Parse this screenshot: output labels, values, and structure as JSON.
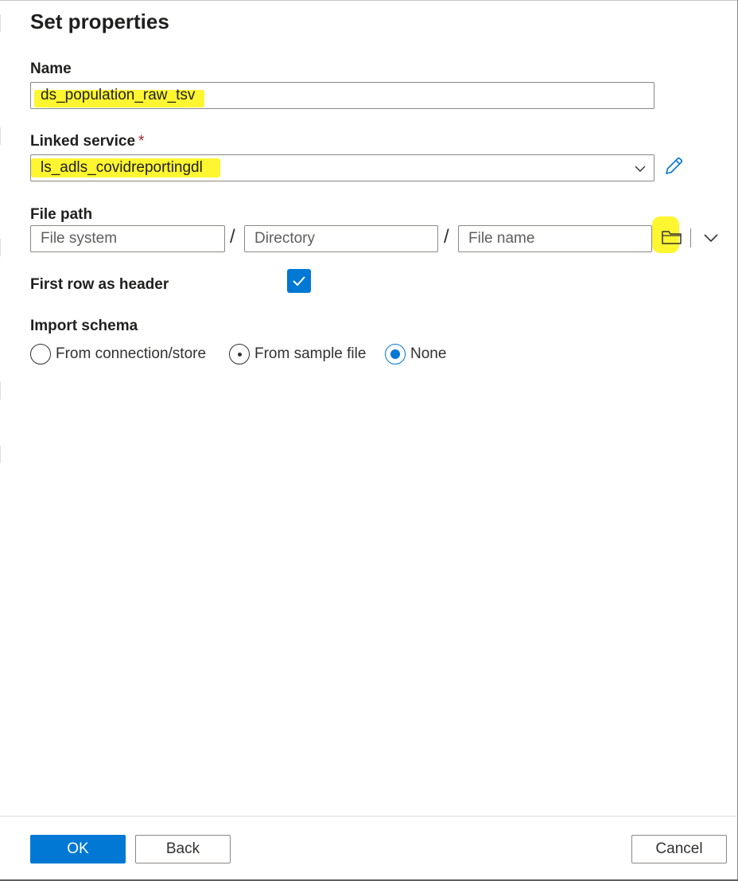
{
  "dialog": {
    "title": "Set properties"
  },
  "name_field": {
    "label": "Name",
    "value": "ds_population_raw_tsv"
  },
  "linked_service": {
    "label": "Linked service",
    "required_mark": "*",
    "value": "ls_adls_covidreportingdl",
    "edit_icon": "pencil-icon",
    "dropdown_icon": "chevron-down-icon"
  },
  "file_path": {
    "label": "File path",
    "file_system_placeholder": "File system",
    "directory_placeholder": "Directory",
    "file_name_placeholder": "File name",
    "separator": "/",
    "browse_icon": "folder-icon",
    "expand_icon": "chevron-down-icon"
  },
  "first_row_header": {
    "label": "First row as header",
    "checked": true
  },
  "import_schema": {
    "label": "Import schema",
    "options": [
      {
        "label": "From connection/store",
        "selected": false
      },
      {
        "label": "From sample file",
        "selected": false
      },
      {
        "label": "None",
        "selected": true
      }
    ]
  },
  "footer": {
    "ok_label": "OK",
    "back_label": "Back",
    "cancel_label": "Cancel"
  },
  "colors": {
    "accent": "#0078d4",
    "highlight": "#fdf525",
    "required": "#a4262c"
  }
}
